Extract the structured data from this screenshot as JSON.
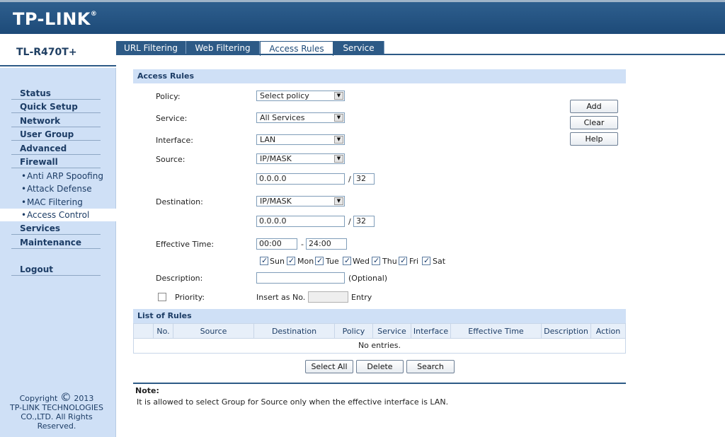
{
  "brand": {
    "logo_text": "TP-LINK",
    "logo_mark": "®",
    "model": "TL-R470T+"
  },
  "tabs": [
    {
      "label": "URL Filtering",
      "active": false
    },
    {
      "label": "Web Filtering",
      "active": false
    },
    {
      "label": "Access Rules",
      "active": true
    },
    {
      "label": "Service",
      "active": false
    }
  ],
  "sidebar": {
    "items": [
      {
        "label": "Status"
      },
      {
        "label": "Quick Setup"
      },
      {
        "label": "Network"
      },
      {
        "label": "User Group"
      },
      {
        "label": "Advanced"
      },
      {
        "label": "Firewall"
      }
    ],
    "subitems": [
      {
        "label": "Anti ARP Spoofing",
        "active": false
      },
      {
        "label": "Attack Defense",
        "active": false
      },
      {
        "label": "MAC Filtering",
        "active": false
      },
      {
        "label": "Access Control",
        "active": true
      }
    ],
    "items_after": [
      {
        "label": "Services"
      },
      {
        "label": "Maintenance"
      }
    ],
    "logout": "Logout",
    "copyright": {
      "line1": "Copyright",
      "symbol": "©",
      "year": "2013",
      "line2": "TP-LINK TECHNOLOGIES",
      "line3": "CO.,LTD. All Rights",
      "line4": "Reserved."
    }
  },
  "form": {
    "section_title": "Access Rules",
    "policy": {
      "label": "Policy:",
      "value": "Select policy"
    },
    "service": {
      "label": "Service:",
      "value": "All Services"
    },
    "interface": {
      "label": "Interface:",
      "value": "LAN"
    },
    "source": {
      "label": "Source:",
      "type": "IP/MASK",
      "ip": "0.0.0.0",
      "slash": "/",
      "mask": "32"
    },
    "destination": {
      "label": "Destination:",
      "type": "IP/MASK",
      "ip": "0.0.0.0",
      "slash": "/",
      "mask": "32"
    },
    "effective_time": {
      "label": "Effective Time:",
      "start": "00:00",
      "dash": "-",
      "end": "24:00"
    },
    "days": [
      {
        "label": "Sun",
        "checked": true
      },
      {
        "label": "Mon",
        "checked": true
      },
      {
        "label": "Tue",
        "checked": true
      },
      {
        "label": "Wed",
        "checked": true
      },
      {
        "label": "Thu",
        "checked": true
      },
      {
        "label": "Fri",
        "checked": true
      },
      {
        "label": "Sat",
        "checked": true
      }
    ],
    "description": {
      "label": "Description:",
      "value": "",
      "hint": "(Optional)"
    },
    "priority": {
      "label": "Priority:",
      "checked": false,
      "insert_label": "Insert as No.",
      "value": "",
      "entry_label": "Entry"
    }
  },
  "side_buttons": {
    "add": "Add",
    "clear": "Clear",
    "help": "Help"
  },
  "rules_table": {
    "section_title": "List of Rules",
    "columns": [
      "",
      "No.",
      "Source",
      "Destination",
      "Policy",
      "Service",
      "Interface",
      "Effective Time",
      "Description",
      "Action"
    ],
    "empty_text": "No entries."
  },
  "table_buttons": {
    "select_all": "Select All",
    "delete": "Delete",
    "search": "Search"
  },
  "note": {
    "title": "Note:",
    "text": "It is allowed to select Group for Source only when the effective interface is LAN."
  },
  "colors": {
    "header_blue": "#1d4a78",
    "sidebar_blue": "#cfe0f6",
    "section_blue": "#cfe0f6"
  }
}
